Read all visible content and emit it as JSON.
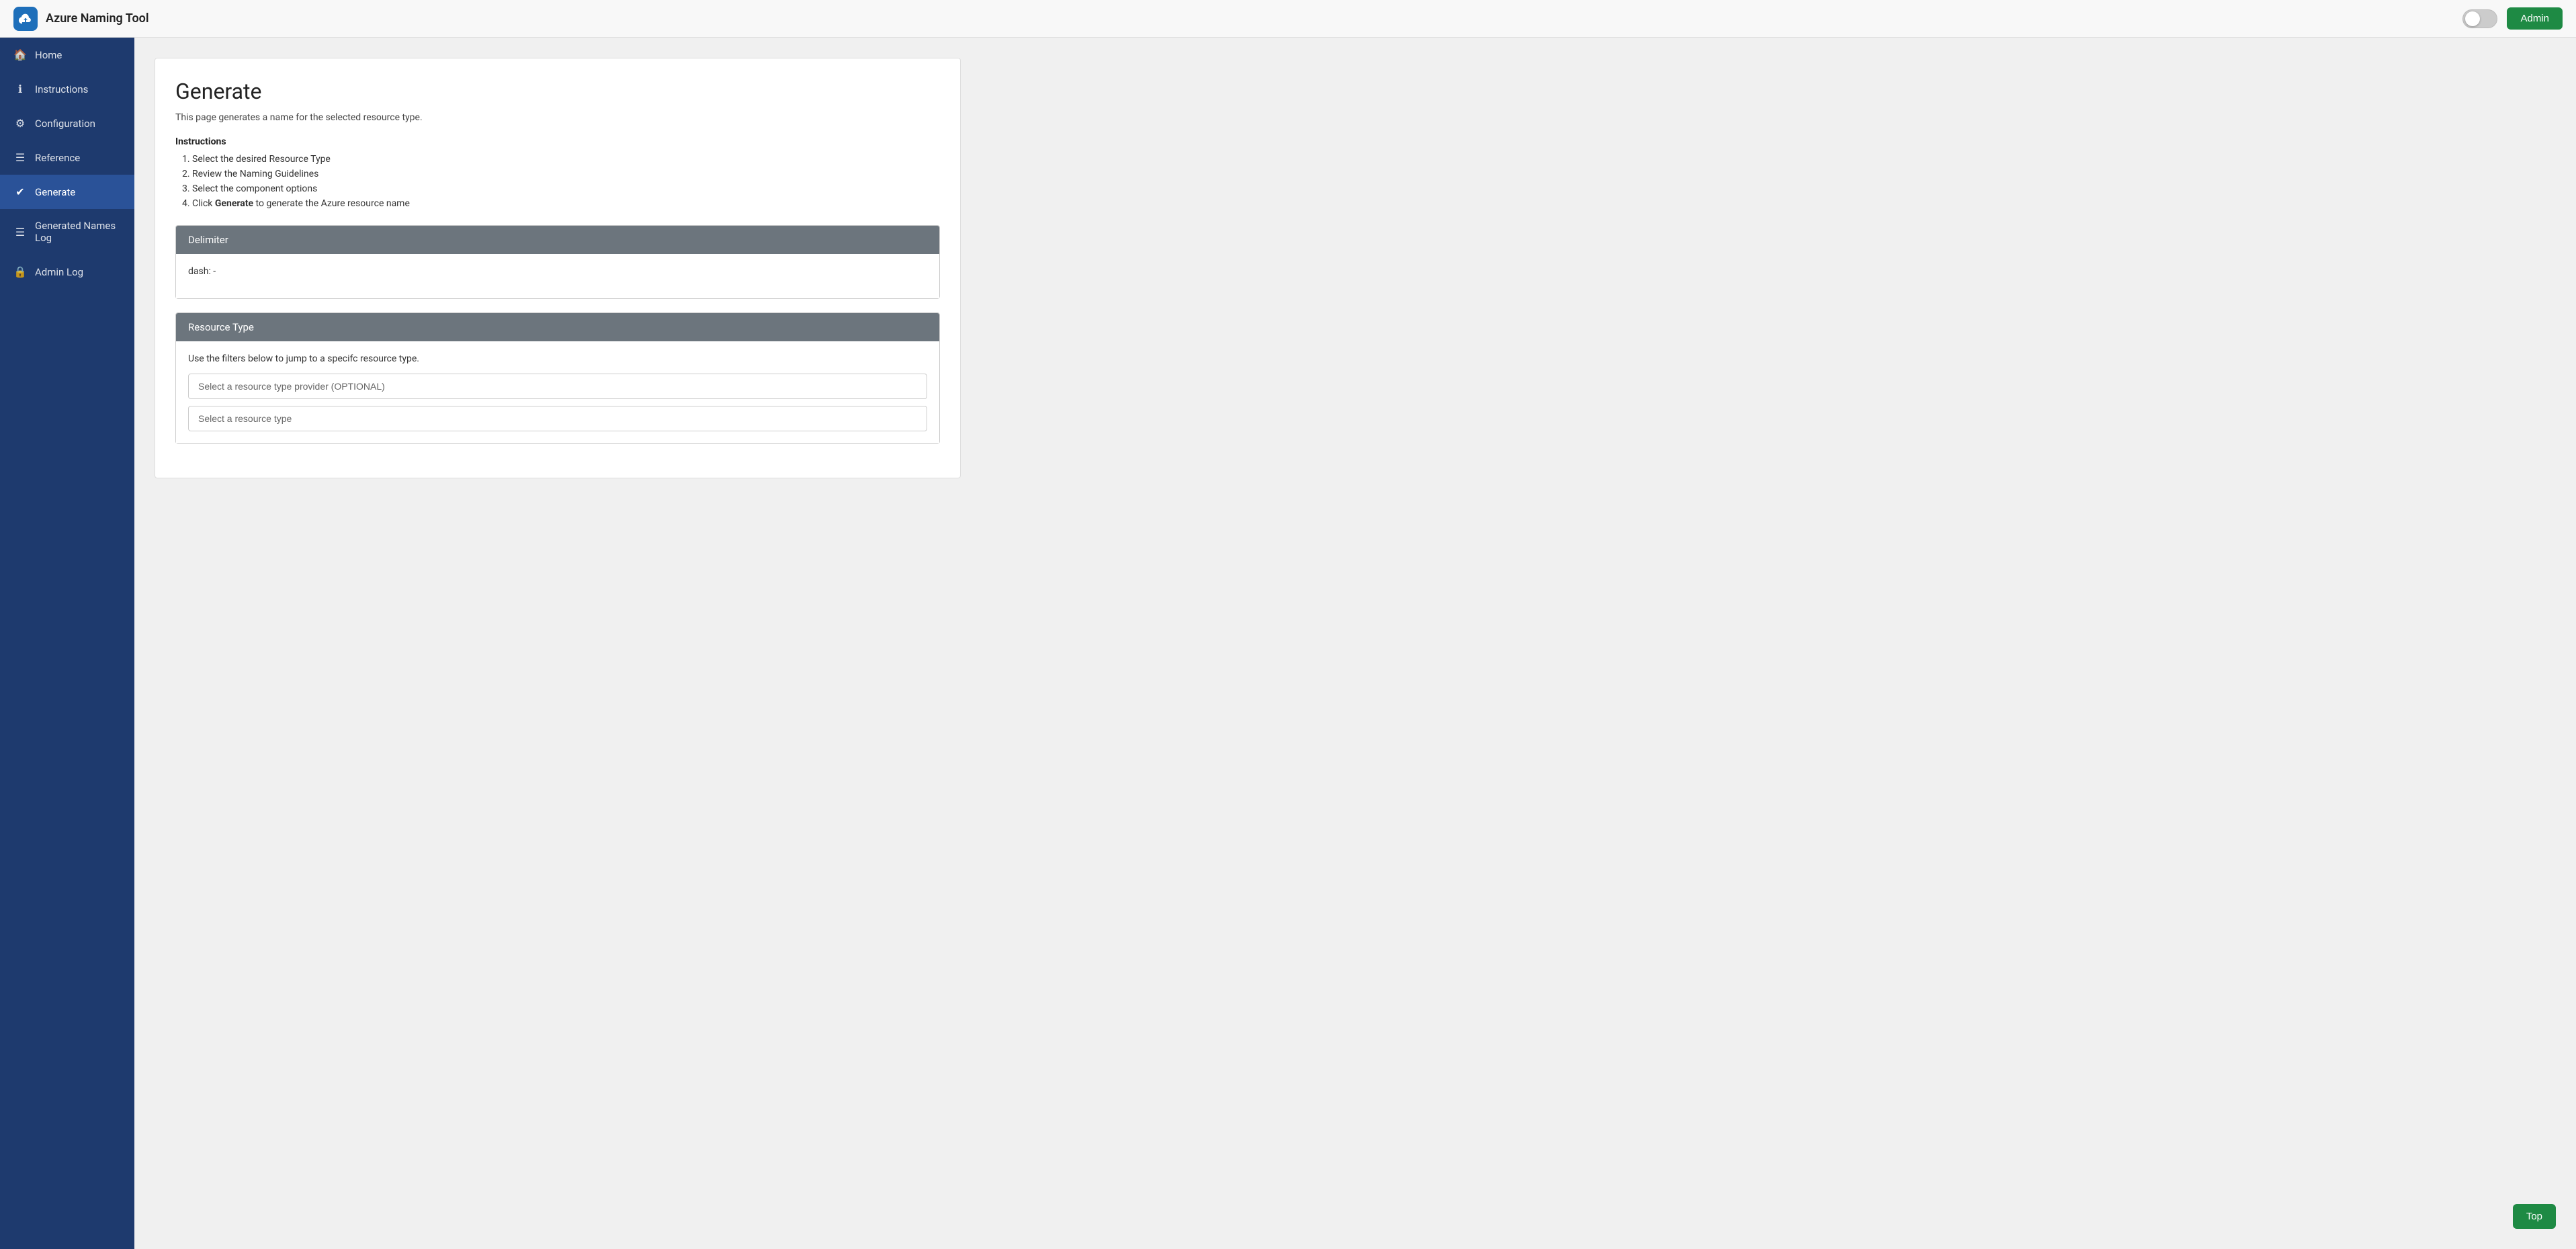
{
  "app": {
    "title": "Azure Naming Tool",
    "admin_button_label": "Admin",
    "top_button_label": "Top"
  },
  "sidebar": {
    "items": [
      {
        "id": "home",
        "label": "Home",
        "icon": "🏠",
        "active": false
      },
      {
        "id": "instructions",
        "label": "Instructions",
        "icon": "ℹ",
        "active": false
      },
      {
        "id": "configuration",
        "label": "Configuration",
        "icon": "⚙",
        "active": false
      },
      {
        "id": "reference",
        "label": "Reference",
        "icon": "☰",
        "active": false
      },
      {
        "id": "generate",
        "label": "Generate",
        "icon": "✔",
        "active": true
      },
      {
        "id": "generated-names-log",
        "label": "Generated Names Log",
        "icon": "☰",
        "active": false
      },
      {
        "id": "admin-log",
        "label": "Admin Log",
        "icon": "🔒",
        "active": false
      }
    ]
  },
  "main": {
    "page_title": "Generate",
    "page_subtitle": "This page generates a name for the selected resource type.",
    "instructions_heading": "Instructions",
    "instructions_steps": [
      "Select the desired Resource Type",
      "Review the Naming Guidelines",
      "Select the component options",
      "Click Generate to generate the Azure resource name"
    ],
    "instructions_step4_bold": "Generate",
    "delimiter_section": {
      "title": "Delimiter",
      "value": "dash: -"
    },
    "resource_type_section": {
      "title": "Resource Type",
      "description": "Use the filters below to jump to a specifc resource type.",
      "provider_placeholder": "Select a resource type provider (OPTIONAL)",
      "type_placeholder": "Select a resource type"
    }
  }
}
